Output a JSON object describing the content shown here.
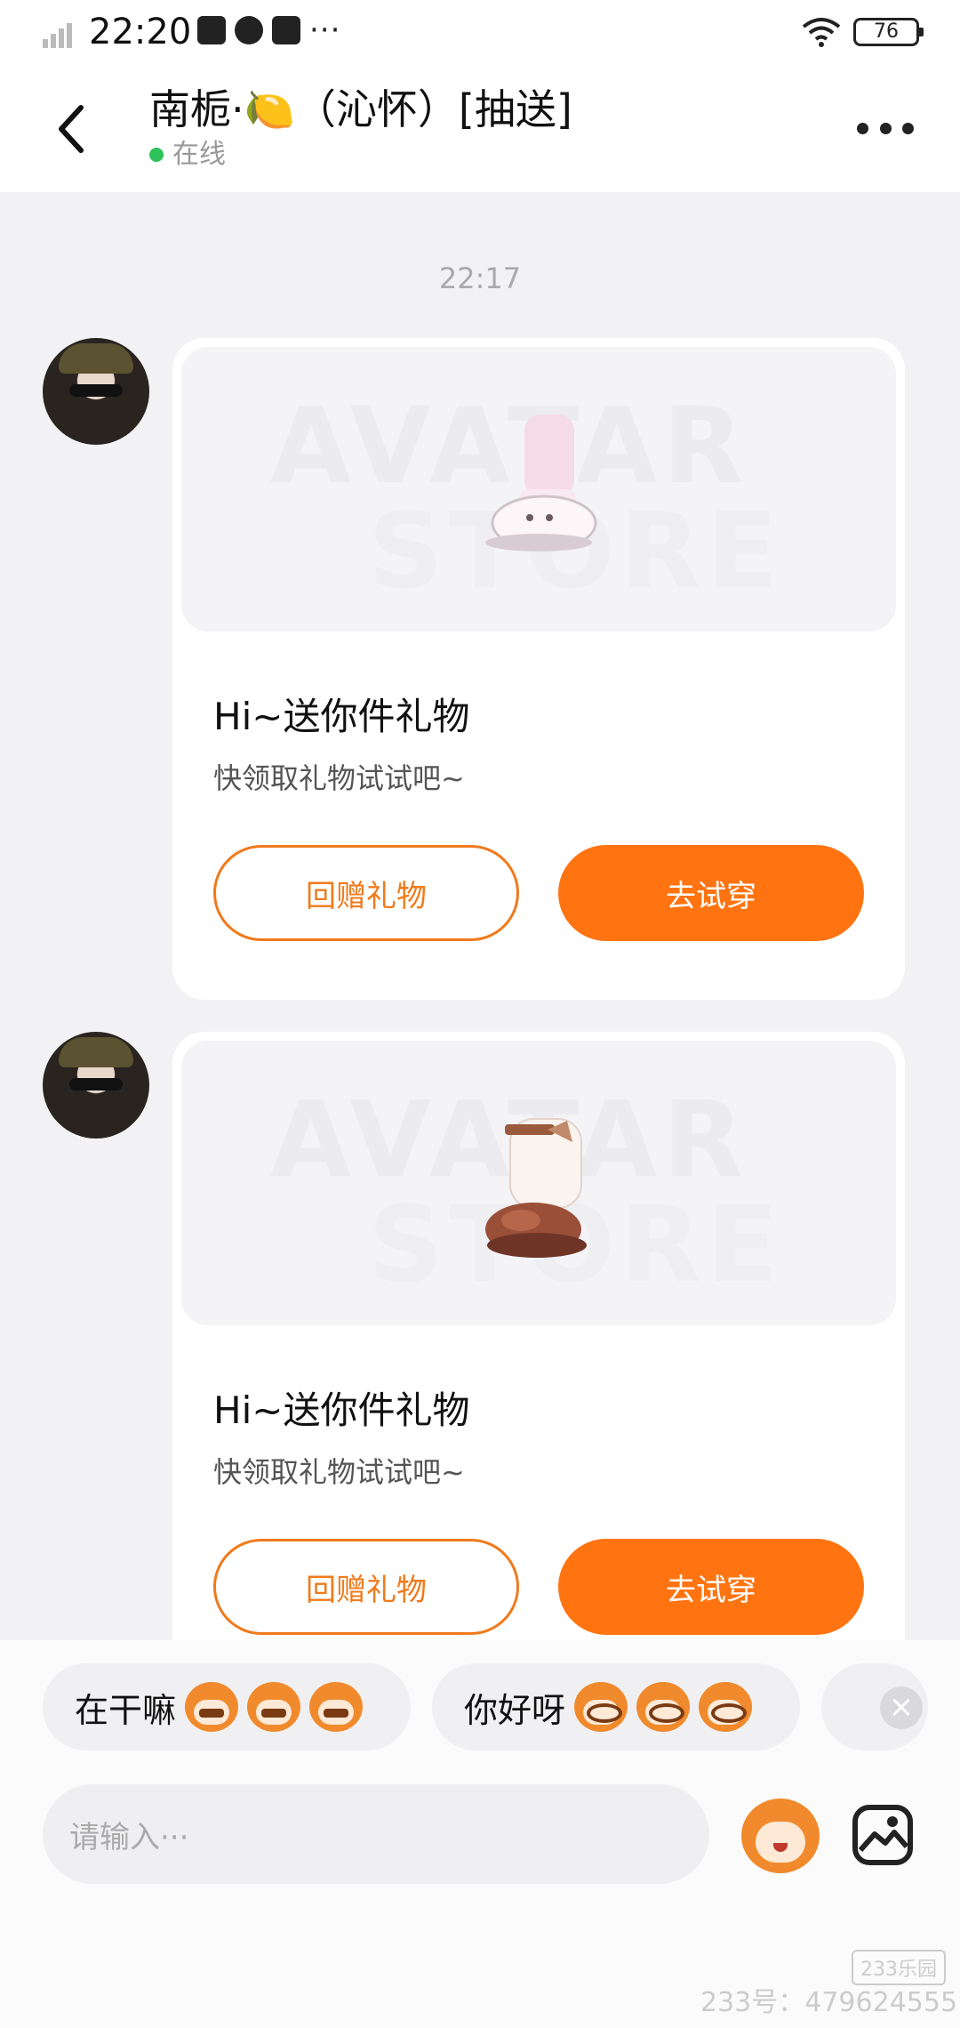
{
  "status_bar": {
    "time": "22:20",
    "battery": "76"
  },
  "header": {
    "back_icon": "chevron-left-icon",
    "title": "南栀·🍋（沁怀）[抽送]",
    "status": "在线",
    "more_icon": "more-horizontal-icon"
  },
  "chat": {
    "timestamp": "22:17",
    "messages": [
      {
        "title": "Hi~送你件礼物",
        "subtitle": "快领取礼物试试吧~",
        "watermark_line1": "AVATAR",
        "watermark_line2": "STORE",
        "button_outline": "回赠礼物",
        "button_fill": "去试穿",
        "item_icon": "pink-boots-icon"
      },
      {
        "title": "Hi~送你件礼物",
        "subtitle": "快领取礼物试试吧~",
        "watermark_line1": "AVATAR",
        "watermark_line2": "STORE",
        "button_outline": "回赠礼物",
        "button_fill": "去试穿",
        "item_icon": "brown-fur-boots-icon"
      }
    ]
  },
  "quick_replies": [
    {
      "text": "在干嘛"
    },
    {
      "text": "你好呀"
    }
  ],
  "input": {
    "placeholder": "请输入···"
  },
  "watermark": {
    "logo": "233乐园",
    "id": "233号：479624555"
  },
  "colors": {
    "accent": "#ff7411",
    "online": "#2fc15a"
  }
}
